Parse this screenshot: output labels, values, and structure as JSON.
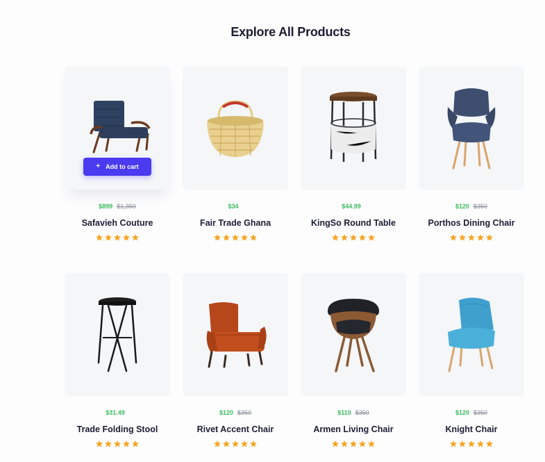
{
  "page": {
    "title": "Explore All Products"
  },
  "products": [
    {
      "name": "Safavieh Couture",
      "price": "$899",
      "old_price": "$1,350",
      "rating": 5,
      "image_icon": "armchair-icon",
      "show_cart": true,
      "cart_label": "Add to cart"
    },
    {
      "name": "Fair Trade Ghana",
      "price": "$34",
      "old_price": "",
      "rating": 5,
      "image_icon": "basket-icon",
      "show_cart": false
    },
    {
      "name": "KingSo Round Table",
      "price": "$44.99",
      "old_price": "",
      "rating": 5,
      "image_icon": "side-table-icon",
      "show_cart": false
    },
    {
      "name": "Porthos Dining Chair",
      "price": "$120",
      "old_price": "$350",
      "rating": 5,
      "image_icon": "dining-chair-icon",
      "show_cart": false
    },
    {
      "name": "Trade Folding Stool",
      "price": "$31.49",
      "old_price": "",
      "rating": 5,
      "image_icon": "folding-stool-icon",
      "show_cart": false
    },
    {
      "name": "Rivet Accent Chair",
      "price": "$120",
      "old_price": "$350",
      "rating": 5,
      "image_icon": "accent-chair-icon",
      "show_cart": false
    },
    {
      "name": "Armen Living Chair",
      "price": "$110",
      "old_price": "$350",
      "rating": 5,
      "image_icon": "swivel-chair-icon",
      "show_cart": false
    },
    {
      "name": "Knight Chair",
      "price": "$120",
      "old_price": "$350",
      "rating": 5,
      "image_icon": "side-chair-icon",
      "show_cart": false
    }
  ],
  "colors": {
    "accent": "#4a3af0",
    "price_green": "#3dbb5e",
    "star": "#f5a623",
    "card_bg": "#f4f6f8"
  }
}
